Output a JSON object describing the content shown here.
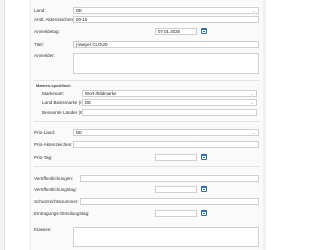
{
  "form": {
    "land_label": "Land:",
    "land_value": "DE",
    "amtl_label": "Amtl. Aktenzeichen:",
    "amtl_value": "00-15",
    "anmeldetag_label": "Anmeldetag:",
    "anmeldetag_value": "07.01.2026",
    "titel_label": "Titel:",
    "titel_value": "j-lawyer CLOUD",
    "anmelder_label": "Anmelder:"
  },
  "marken": {
    "section_label": "Marken-spezifisch",
    "markenart_label": "Markenart:",
    "markenart_value": "Wort-/Bildmarke",
    "basismarke_label": "Land Basismarke (IR):",
    "basismarke_value": "DE",
    "benannte_label": "Benannte Länder (IR):",
    "benannte_value": ""
  },
  "prio": {
    "land_label": "Prio-Land:",
    "land_value": "DE",
    "akten_label": "Prio-Aktenzeichen:",
    "tag_label": "Prio-Tag:"
  },
  "meta": {
    "veroeff_label": "Veröffentlichungen:",
    "veroeff_tag_label": "Veröffentlichungstag:",
    "schutz_label": "Schutzrechtsnummer:",
    "eintragung_label": "Eintragungs-/Erteilungstag:",
    "klassen_label": "Klassen:"
  }
}
